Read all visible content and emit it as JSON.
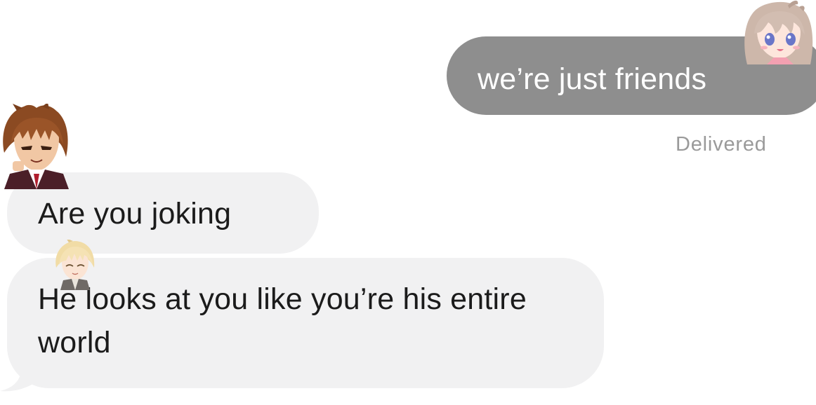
{
  "conversation": {
    "messages": [
      {
        "direction": "sent",
        "text": "we’re just friends",
        "status": "Delivered"
      },
      {
        "direction": "received",
        "text": "Are you joking"
      },
      {
        "direction": "received",
        "text": "He looks at you like you’re his entire world"
      }
    ]
  },
  "stickers": {
    "top_right": "anime-girl-avatar-sticker",
    "left_upper": "anime-boy-avatar-sticker",
    "left_lower": "blond-anime-avatar-sticker"
  },
  "colors": {
    "sent_bubble": "#8e8e8e",
    "received_bubble": "#f1f1f2",
    "sent_text": "#ffffff",
    "received_text": "#1b1b1b",
    "status_text": "#9a9a9a",
    "background": "#ffffff"
  }
}
